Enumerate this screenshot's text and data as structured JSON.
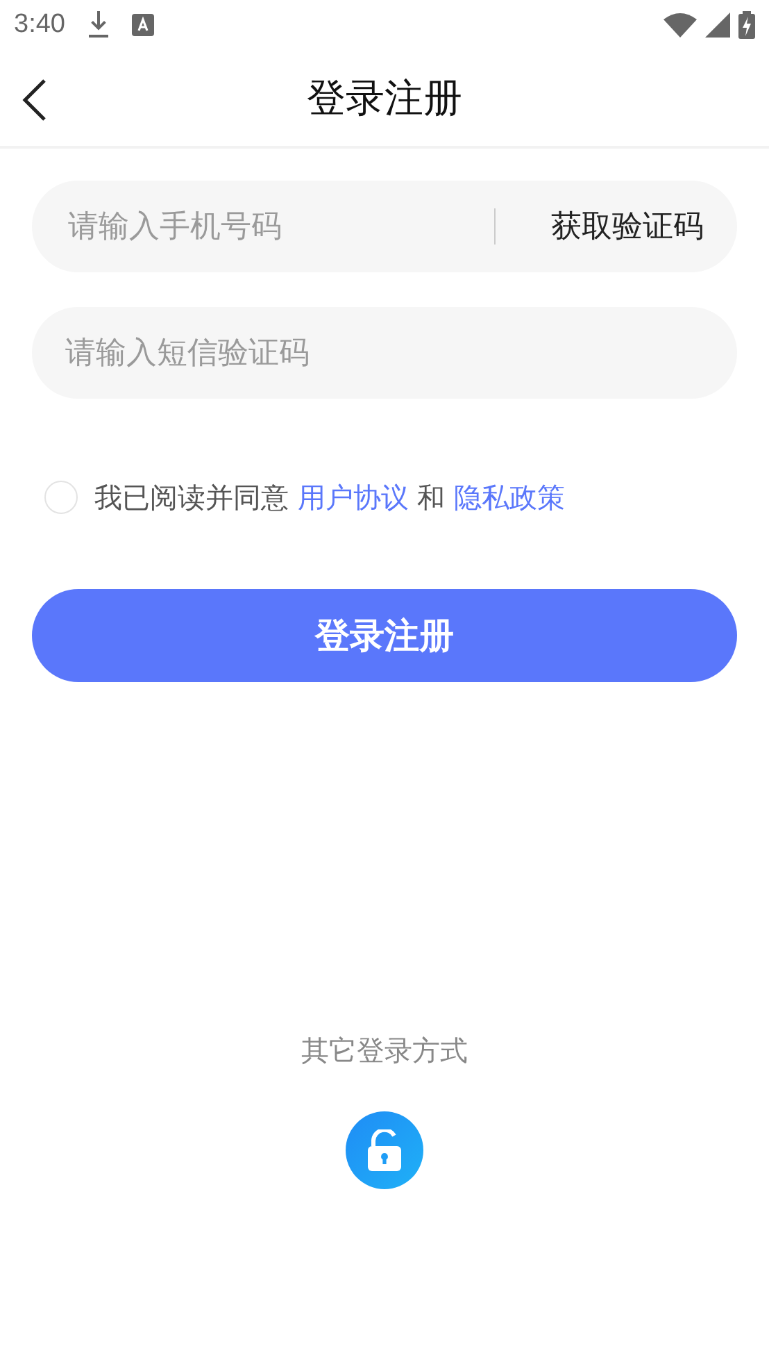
{
  "status_bar": {
    "time": "3:40"
  },
  "header": {
    "title": "登录注册"
  },
  "phone_field": {
    "placeholder": "请输入手机号码",
    "action": "获取验证码"
  },
  "code_field": {
    "placeholder": "请输入短信验证码"
  },
  "agreement": {
    "checked": false,
    "prefix": "我已阅读并同意",
    "terms": "用户协议",
    "middle": "和",
    "privacy": "隐私政策"
  },
  "submit": "登录注册",
  "other_login": {
    "label": "其它登录方式"
  }
}
